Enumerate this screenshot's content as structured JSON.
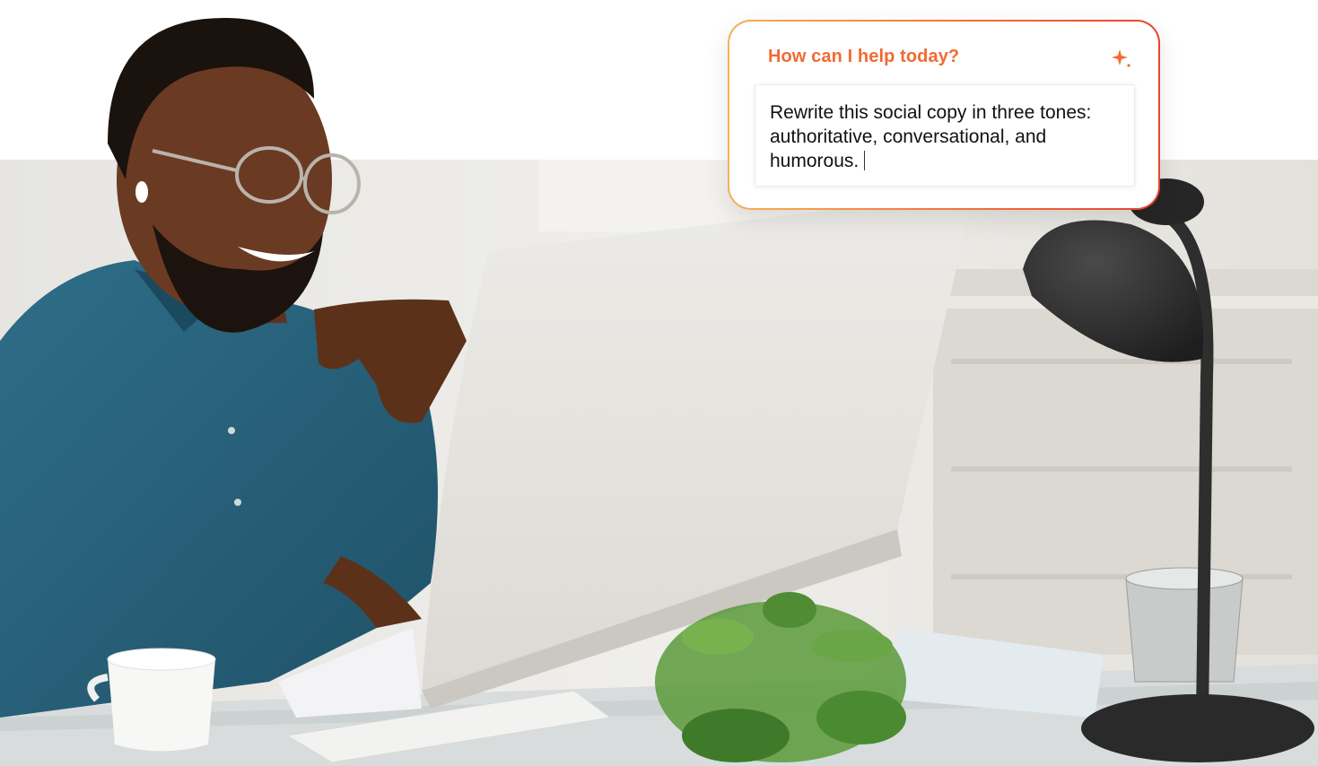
{
  "prompt_card": {
    "title": "How can I help today?",
    "input_text": "Rewrite this social copy in three tones: authoritative, conversational, and humorous.",
    "sparkle_icon": "sparkle-icon"
  },
  "colors": {
    "accent_orange": "#f26a32",
    "gradient_start": "#f7b05a",
    "gradient_end": "#e8432e",
    "shirt_teal": "#27607a",
    "skin": "#6b3a22",
    "lamp": "#2e2e2e",
    "plant_green": "#5a9a3a"
  },
  "icons": [
    "sparkle-icon"
  ]
}
